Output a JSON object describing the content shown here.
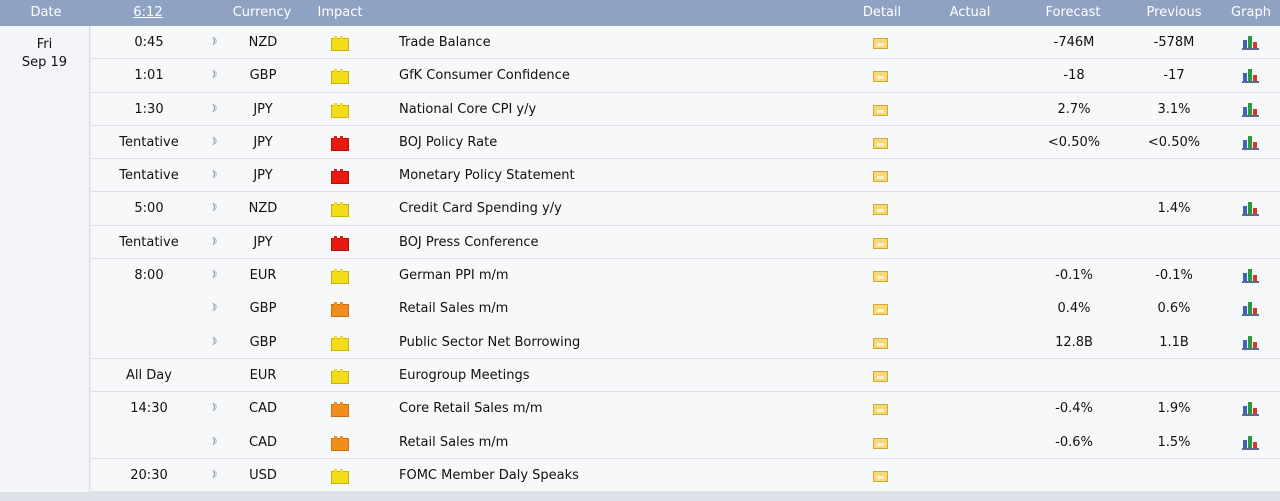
{
  "header": {
    "date": "Date",
    "time": "6:12",
    "currency": "Currency",
    "impact": "Impact",
    "detail": "Detail",
    "actual": "Actual",
    "forecast": "Forecast",
    "previous": "Previous",
    "graph": "Graph"
  },
  "day": {
    "weekday": "Fri",
    "date": "Sep 19"
  },
  "colors": {
    "header_bg": "#8fa2c3",
    "impact_low": "#f5dc1a",
    "impact_medium": "#f28c1c",
    "impact_high": "#e81a10"
  },
  "events": [
    {
      "time": "0:45",
      "currency": "NZD",
      "impact": "yellow",
      "event": "Trade Balance",
      "actual": "",
      "forecast": "-746M",
      "previous": "-578M",
      "graph": true
    },
    {
      "time": "1:01",
      "currency": "GBP",
      "impact": "yellow",
      "event": "GfK Consumer Confidence",
      "actual": "",
      "forecast": "-18",
      "previous": "-17",
      "graph": true
    },
    {
      "time": "1:30",
      "currency": "JPY",
      "impact": "yellow",
      "event": "National Core CPI y/y",
      "actual": "",
      "forecast": "2.7%",
      "previous": "3.1%",
      "graph": true
    },
    {
      "time": "Tentative",
      "currency": "JPY",
      "impact": "red",
      "event": "BOJ Policy Rate",
      "actual": "",
      "forecast": "<0.50%",
      "previous": "<0.50%",
      "graph": true
    },
    {
      "time": "Tentative",
      "currency": "JPY",
      "impact": "red",
      "event": "Monetary Policy Statement",
      "actual": "",
      "forecast": "",
      "previous": "",
      "graph": false
    },
    {
      "time": "5:00",
      "currency": "NZD",
      "impact": "yellow",
      "event": "Credit Card Spending y/y",
      "actual": "",
      "forecast": "",
      "previous": "1.4%",
      "graph": true
    },
    {
      "time": "Tentative",
      "currency": "JPY",
      "impact": "red",
      "event": "BOJ Press Conference",
      "actual": "",
      "forecast": "",
      "previous": "",
      "graph": false
    },
    {
      "time": "8:00",
      "currency": "EUR",
      "impact": "yellow",
      "event": "German PPI m/m",
      "actual": "",
      "forecast": "-0.1%",
      "previous": "-0.1%",
      "graph": true,
      "nb": true
    },
    {
      "time": "",
      "currency": "GBP",
      "impact": "orange",
      "event": "Retail Sales m/m",
      "actual": "",
      "forecast": "0.4%",
      "previous": "0.6%",
      "graph": true,
      "nb": true
    },
    {
      "time": "",
      "currency": "GBP",
      "impact": "yellow",
      "event": "Public Sector Net Borrowing",
      "actual": "",
      "forecast": "12.8B",
      "previous": "1.1B",
      "graph": true
    },
    {
      "time": "All Day",
      "currency": "EUR",
      "impact": "yellow",
      "event": "Eurogroup Meetings",
      "actual": "",
      "forecast": "",
      "previous": "",
      "graph": false,
      "nosound": true
    },
    {
      "time": "14:30",
      "currency": "CAD",
      "impact": "orange",
      "event": "Core Retail Sales m/m",
      "actual": "",
      "forecast": "-0.4%",
      "previous": "1.9%",
      "graph": true,
      "nb": true
    },
    {
      "time": "",
      "currency": "CAD",
      "impact": "orange",
      "event": "Retail Sales m/m",
      "actual": "",
      "forecast": "-0.6%",
      "previous": "1.5%",
      "graph": true
    },
    {
      "time": "20:30",
      "currency": "USD",
      "impact": "yellow",
      "event": "FOMC Member Daly Speaks",
      "actual": "",
      "forecast": "",
      "previous": "",
      "graph": false
    }
  ]
}
